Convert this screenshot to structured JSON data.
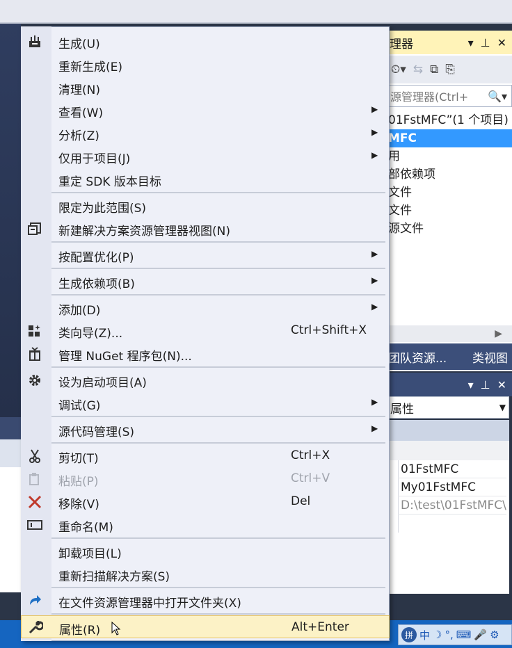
{
  "solution_explorer": {
    "title_fragment": "理器",
    "search_placeholder": "源管理器(Ctrl+",
    "tree": [
      {
        "label": "01FstMFC”(1 个项目)",
        "selected": false
      },
      {
        "label": "MFC",
        "selected": true
      },
      {
        "label": "用",
        "selected": false
      },
      {
        "label": "部依赖项",
        "selected": false
      },
      {
        "label": "文件",
        "selected": false
      },
      {
        "label": "文件",
        "selected": false
      },
      {
        "label": "源文件",
        "selected": false
      }
    ],
    "tab_team": "团队资源...",
    "tab_class": "类视图"
  },
  "properties": {
    "selector_text": "属性",
    "rows": [
      {
        "value": "01FstMFC",
        "dim": false
      },
      {
        "value": "My01FstMFC",
        "dim": false
      },
      {
        "value": "D:\\test\\01FstMFC\\",
        "dim": true
      }
    ]
  },
  "taskbar": {
    "ime": "中",
    "ime_icons": [
      "☽",
      "°,",
      "⌨",
      "🎤",
      "⚙"
    ]
  },
  "menu": {
    "items": [
      {
        "label": "生成(U)",
        "shortcut": "",
        "submenu": false,
        "icon": "build-icon"
      },
      {
        "label": "重新生成(E)",
        "shortcut": "",
        "submenu": false,
        "icon": ""
      },
      {
        "label": "清理(N)",
        "shortcut": "",
        "submenu": false,
        "icon": ""
      },
      {
        "label": "查看(W)",
        "shortcut": "",
        "submenu": true,
        "icon": ""
      },
      {
        "label": "分析(Z)",
        "shortcut": "",
        "submenu": true,
        "icon": ""
      },
      {
        "label": "仅用于项目(J)",
        "shortcut": "",
        "submenu": true,
        "icon": ""
      },
      {
        "label": "重定 SDK 版本目标",
        "shortcut": "",
        "submenu": false,
        "icon": ""
      },
      {
        "label": "限定为此范围(S)",
        "shortcut": "",
        "submenu": false,
        "icon": ""
      },
      {
        "label": "新建解决方案资源管理器视图(N)",
        "shortcut": "",
        "submenu": false,
        "icon": "new-view-icon"
      },
      {
        "label": "按配置优化(P)",
        "shortcut": "",
        "submenu": true,
        "icon": ""
      },
      {
        "label": "生成依赖项(B)",
        "shortcut": "",
        "submenu": true,
        "icon": ""
      },
      {
        "label": "添加(D)",
        "shortcut": "",
        "submenu": true,
        "icon": ""
      },
      {
        "label": "类向导(Z)...",
        "shortcut": "Ctrl+Shift+X",
        "submenu": false,
        "icon": "class-wizard-icon"
      },
      {
        "label": "管理 NuGet 程序包(N)...",
        "shortcut": "",
        "submenu": false,
        "icon": "nuget-icon"
      },
      {
        "label": "设为启动项目(A)",
        "shortcut": "",
        "submenu": false,
        "icon": "gear-icon"
      },
      {
        "label": "调试(G)",
        "shortcut": "",
        "submenu": true,
        "icon": ""
      },
      {
        "label": "源代码管理(S)",
        "shortcut": "",
        "submenu": true,
        "icon": ""
      },
      {
        "label": "剪切(T)",
        "shortcut": "Ctrl+X",
        "submenu": false,
        "icon": "scissors-icon"
      },
      {
        "label": "粘贴(P)",
        "shortcut": "Ctrl+V",
        "submenu": false,
        "icon": "paste-icon",
        "disabled": true
      },
      {
        "label": "移除(V)",
        "shortcut": "Del",
        "submenu": false,
        "icon": "remove-icon"
      },
      {
        "label": "重命名(M)",
        "shortcut": "",
        "submenu": false,
        "icon": "rename-icon"
      },
      {
        "label": "卸载项目(L)",
        "shortcut": "",
        "submenu": false,
        "icon": ""
      },
      {
        "label": "重新扫描解决方案(S)",
        "shortcut": "",
        "submenu": false,
        "icon": ""
      },
      {
        "label": "在文件资源管理器中打开文件夹(X)",
        "shortcut": "",
        "submenu": false,
        "icon": "open-folder-icon"
      },
      {
        "label": "属性(R)",
        "shortcut": "Alt+Enter",
        "submenu": false,
        "icon": "wrench-icon",
        "hover": true
      }
    ]
  }
}
